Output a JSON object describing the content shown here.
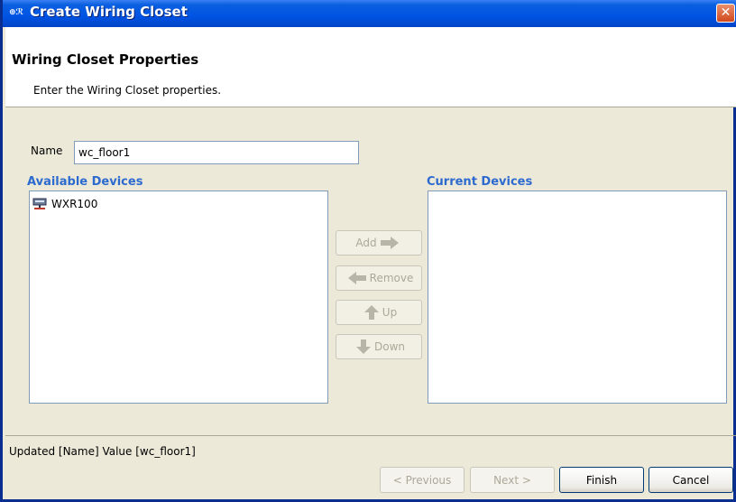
{
  "window": {
    "title": "Create Wiring Closet",
    "app_icon_glyph": "⊕ℛ",
    "close_glyph": "✕"
  },
  "header": {
    "title": "Wiring Closet Properties",
    "description": "Enter the Wiring Closet properties."
  },
  "form": {
    "name_label": "Name",
    "name_value": "wc_floor1"
  },
  "available_devices": {
    "label": "Available Devices",
    "items": [
      {
        "label": "WXR100",
        "icon": "network-device-icon"
      }
    ]
  },
  "current_devices": {
    "label": "Current Devices",
    "items": []
  },
  "actions": {
    "add": "Add",
    "remove": "Remove",
    "up": "Up",
    "down": "Down"
  },
  "status": {
    "text": "Updated [Name] Value [wc_floor1]"
  },
  "footer": {
    "previous": "< Previous",
    "next": "Next >",
    "finish": "Finish",
    "cancel": "Cancel"
  },
  "colors": {
    "titlebar": "#0054E3",
    "section_label": "#2D6ACF",
    "arrow_disabled": "#B7B5A8",
    "window_bg": "#ECE9D8"
  }
}
